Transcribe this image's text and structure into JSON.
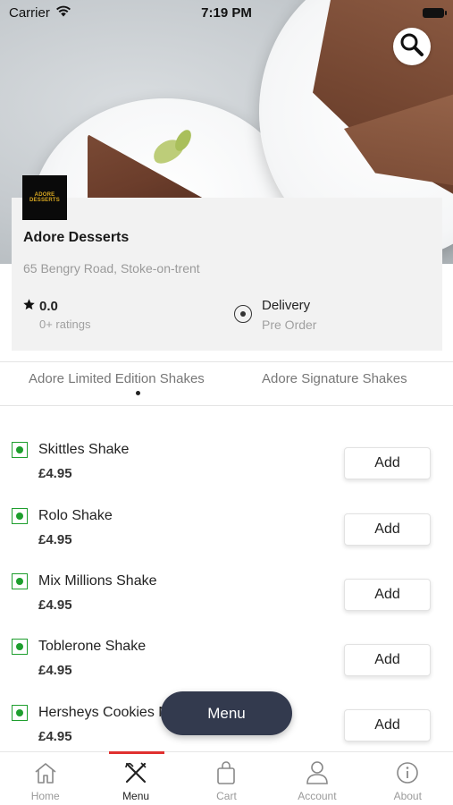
{
  "status_bar": {
    "carrier": "Carrier",
    "time": "7:19 PM"
  },
  "restaurant": {
    "logo_text": "ADORE DESSERTS",
    "name": "Adore Desserts",
    "address": "65 Bengry Road, Stoke-on-trent",
    "rating": "0.0",
    "ratings_count": "0+ ratings",
    "delivery_title": "Delivery",
    "delivery_sub": "Pre Order"
  },
  "tabs": [
    {
      "label": "Adore Limited Edition Shakes",
      "active": true
    },
    {
      "label": "Adore Signature Shakes",
      "active": false
    }
  ],
  "products": [
    {
      "name": "Skittles Shake",
      "price": "£4.95",
      "button": "Add"
    },
    {
      "name": "Rolo Shake",
      "price": "£4.95",
      "button": "Add"
    },
    {
      "name": "Mix Millions Shake",
      "price": "£4.95",
      "button": "Add"
    },
    {
      "name": "Toblerone Shake",
      "price": "£4.95",
      "button": "Add"
    },
    {
      "name": "Hersheys Cookies N Creme Shake",
      "price": "£4.95",
      "button": "Add"
    }
  ],
  "menu_pill": "Menu",
  "bottom_nav": [
    {
      "label": "Home",
      "icon": "home-icon",
      "active": false
    },
    {
      "label": "Menu",
      "icon": "fork-knife-icon",
      "active": true
    },
    {
      "label": "Cart",
      "icon": "bag-icon",
      "active": false
    },
    {
      "label": "Account",
      "icon": "person-icon",
      "active": false
    },
    {
      "label": "About",
      "icon": "info-icon",
      "active": false
    }
  ],
  "colors": {
    "accent": "#e0302f",
    "veg_green": "#1e9e2e",
    "pill_bg": "#333a4e"
  }
}
